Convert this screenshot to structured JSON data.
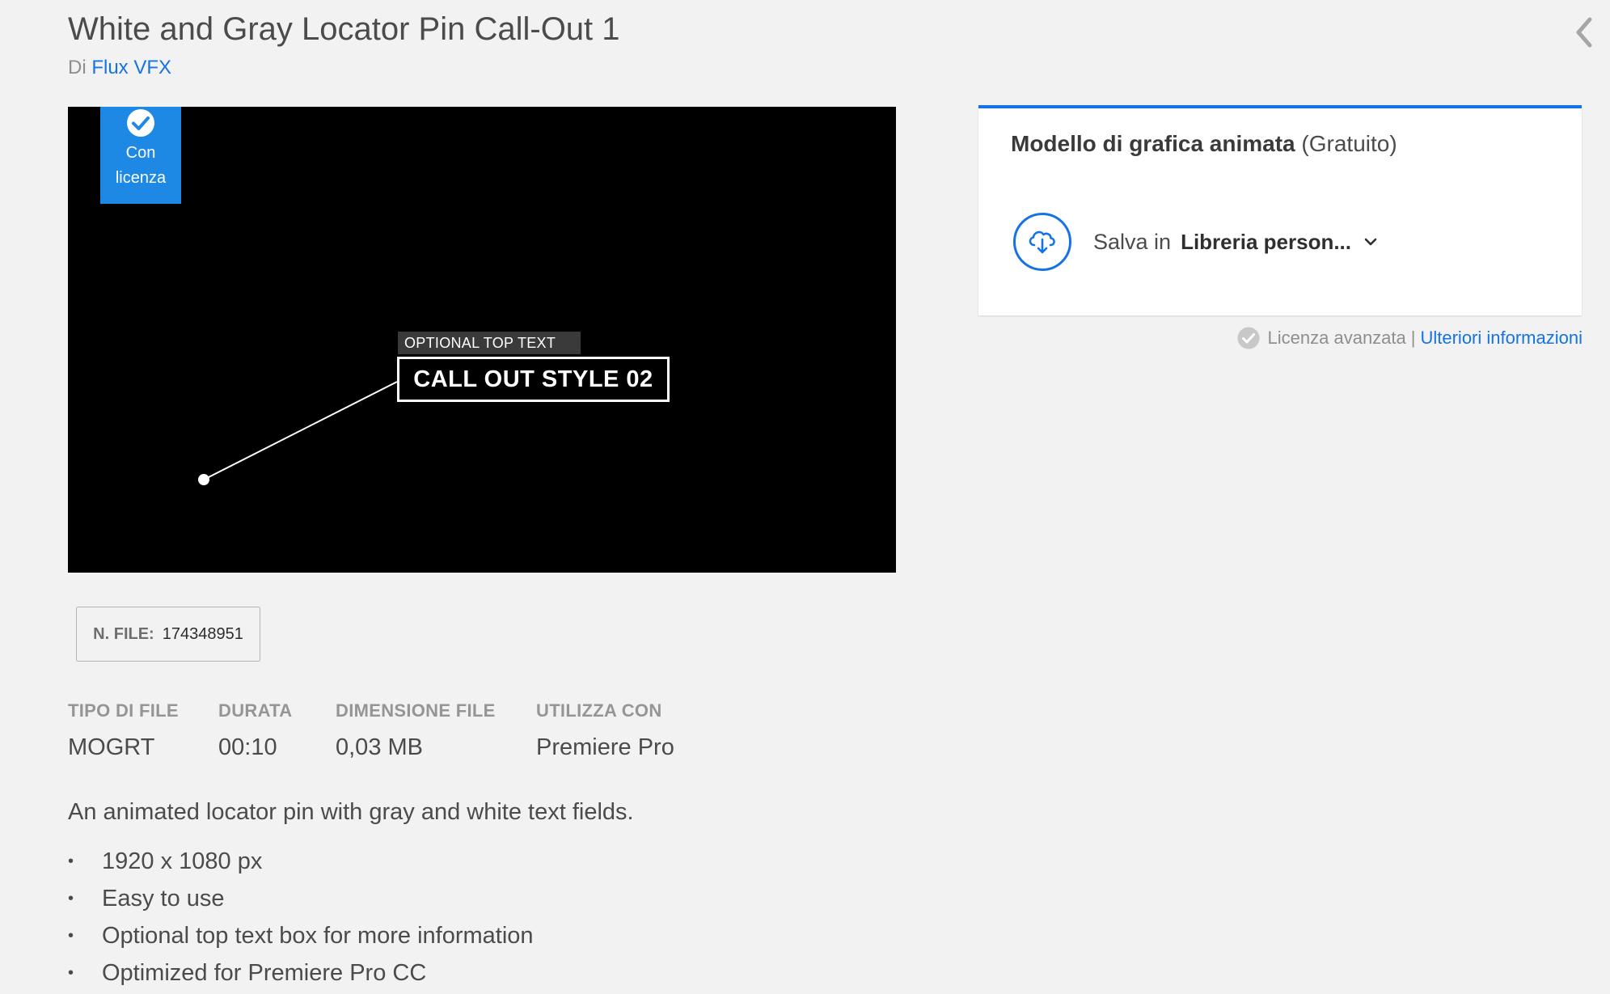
{
  "header": {
    "title": "White and Gray Locator Pin Call-Out 1",
    "byline_prefix": "Di",
    "author": "Flux VFX"
  },
  "preview": {
    "badge_text": "Con licenza",
    "top_text": "OPTIONAL TOP TEXT",
    "callout_text": "CALL OUT STYLE 02"
  },
  "file_id": {
    "label": "N. FILE:",
    "value": "174348951"
  },
  "meta": [
    {
      "key": "TIPO DI FILE",
      "value": "MOGRT"
    },
    {
      "key": "DURATA",
      "value": "00:10"
    },
    {
      "key": "DIMENSIONE FILE",
      "value": "0,03 MB"
    },
    {
      "key": "UTILIZZA CON",
      "value": "Premiere Pro"
    }
  ],
  "description": "An animated locator pin with gray and white text fields.",
  "features": [
    "1920 x 1080 px",
    "Easy to use",
    "Optional top text box for more information",
    "Optimized for Premiere Pro CC"
  ],
  "panel": {
    "title_strong": "Modello di grafica animata",
    "title_light": "(Gratuito)",
    "save_label": "Salva in",
    "library": "Libreria person..."
  },
  "license": {
    "text": "Licenza avanzata",
    "separator": "|",
    "link": "Ulteriori informazioni"
  },
  "colors": {
    "accent": "#1473e6",
    "badge": "#1e88e5",
    "background": "#f2f2f2"
  },
  "icons": {
    "collapse": "chevron-left-icon",
    "badge": "checkmark-circle-icon",
    "save": "cloud-download-icon",
    "dropdown": "chevron-down-icon",
    "license": "check-circle-icon"
  }
}
